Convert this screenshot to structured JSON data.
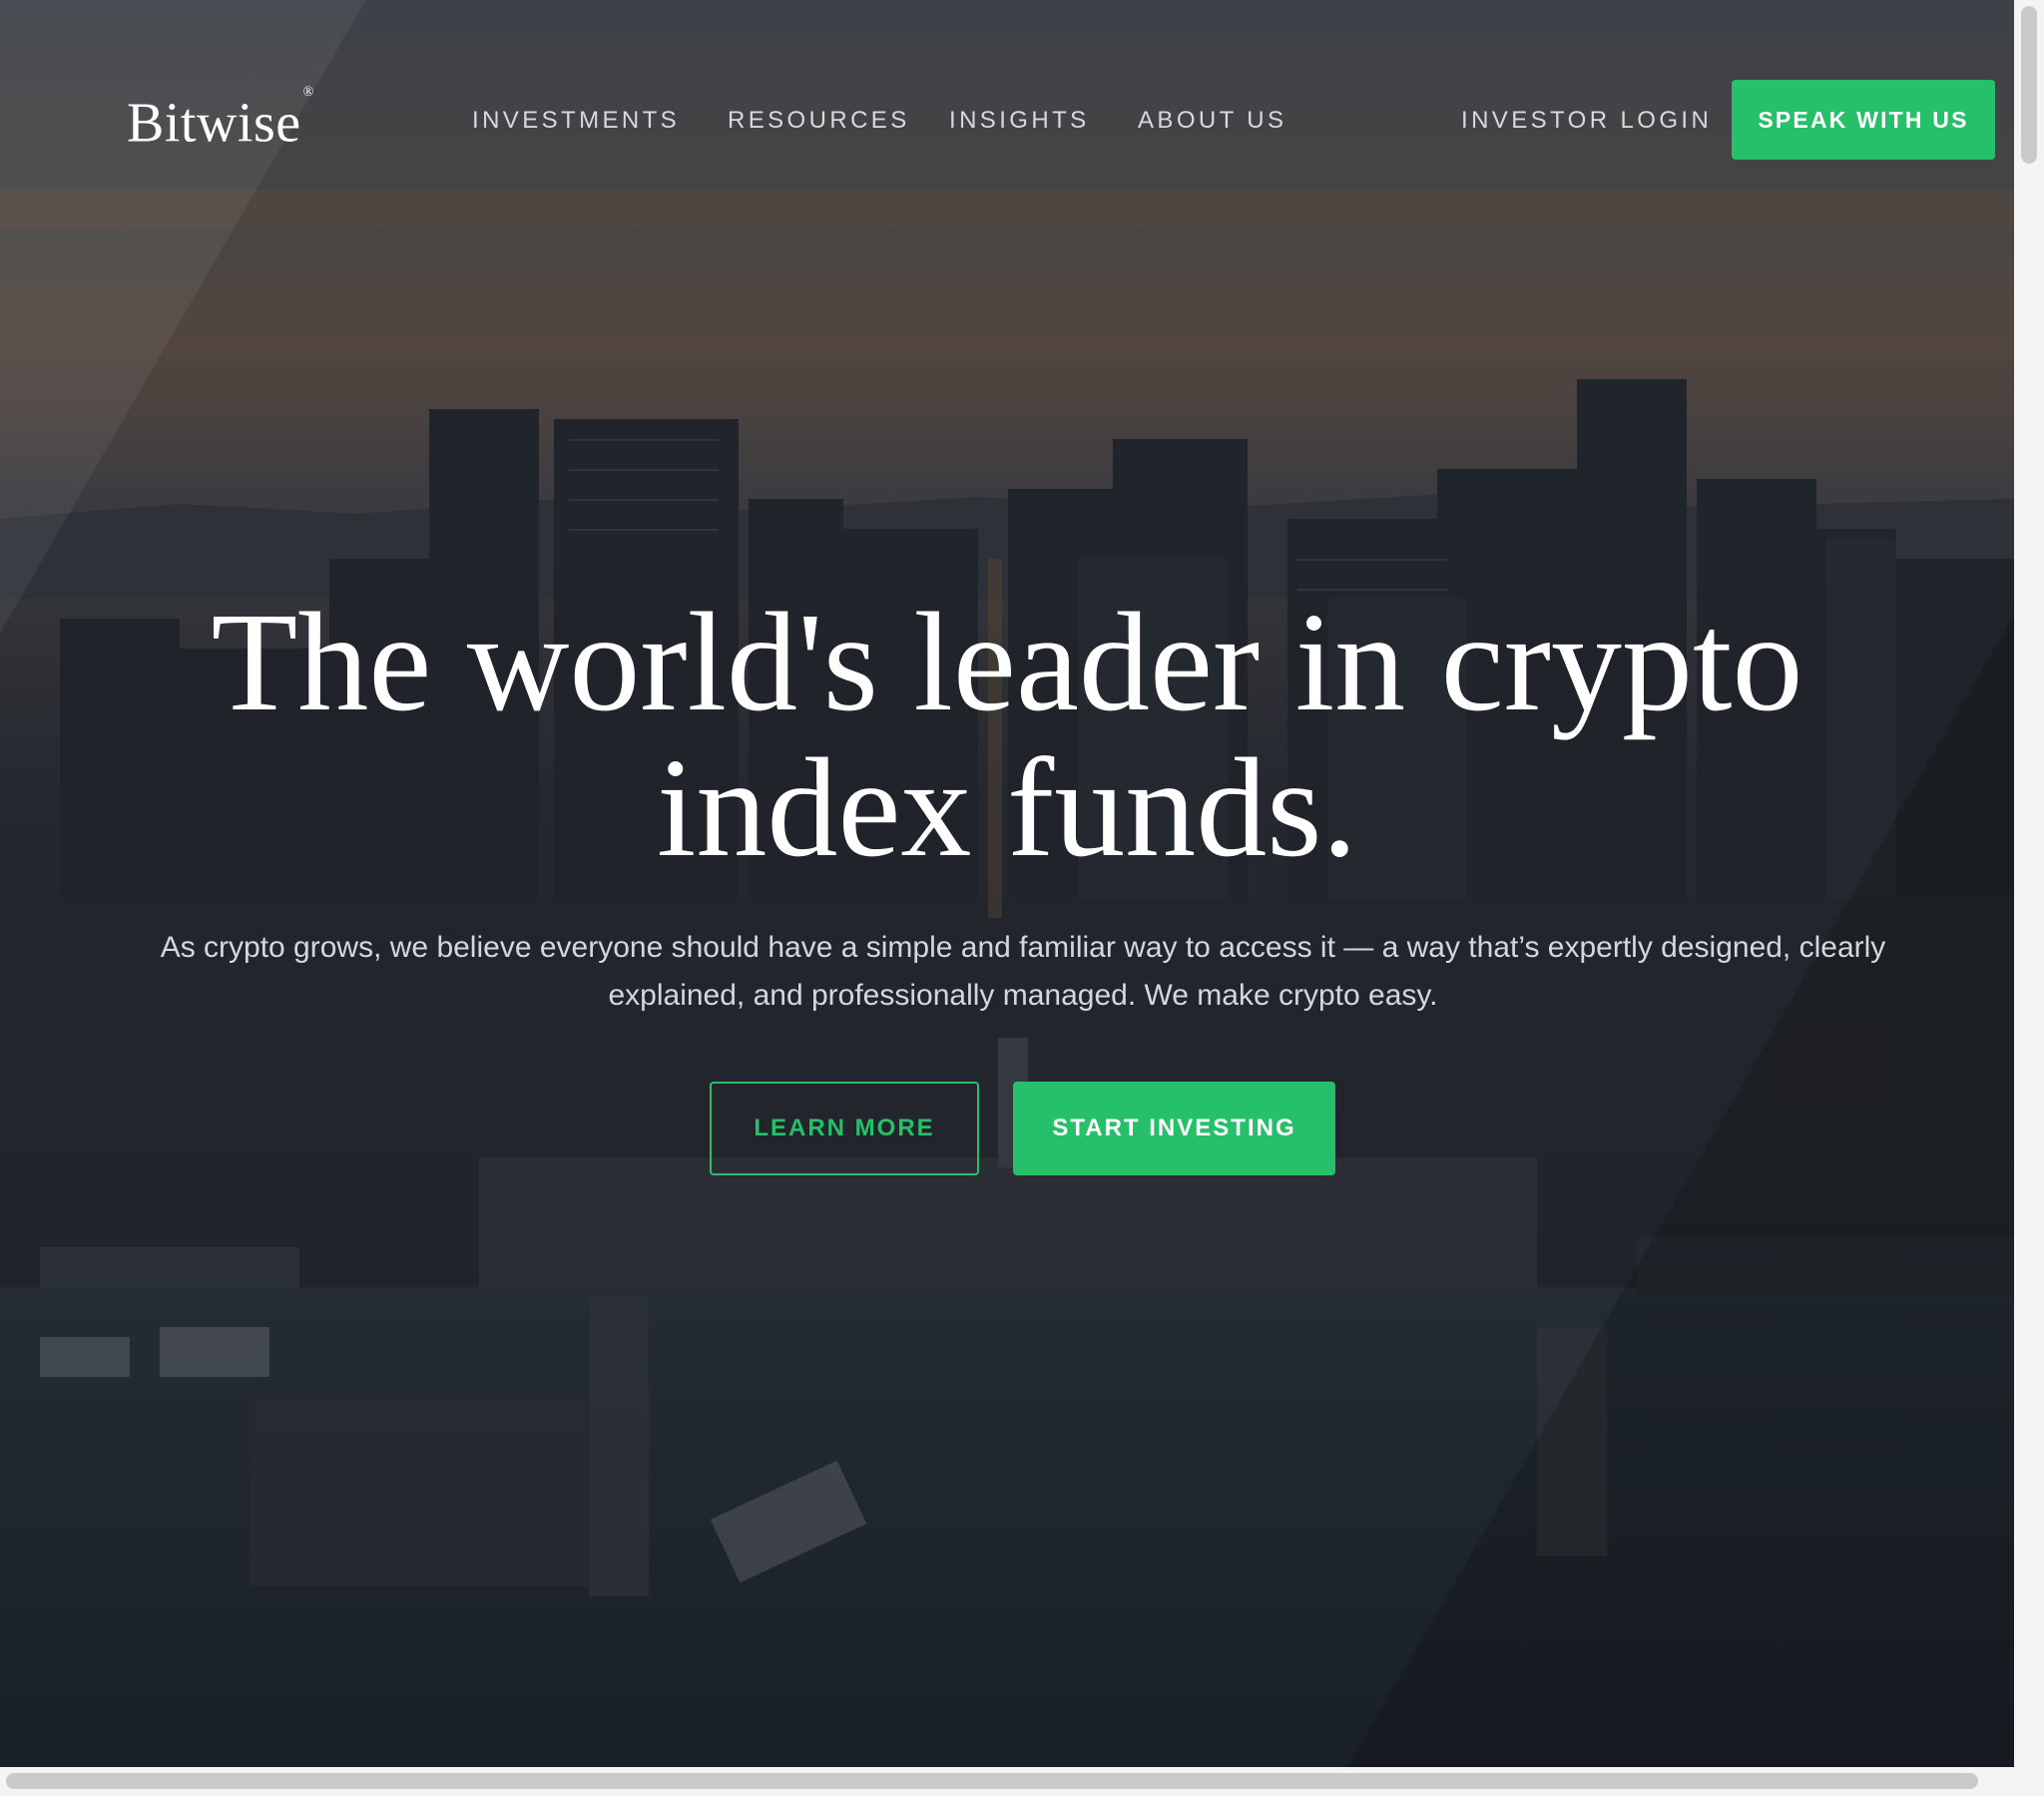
{
  "header": {
    "logo": "Bitwise",
    "logo_mark": "®",
    "nav": [
      {
        "label": "INVESTMENTS"
      },
      {
        "label": "RESOURCES"
      },
      {
        "label": "INSIGHTS"
      },
      {
        "label": "ABOUT US"
      }
    ],
    "login_label": "INVESTOR LOGIN",
    "cta_label": "SPEAK WITH US"
  },
  "hero": {
    "title": "The world's leader in crypto index funds.",
    "subtitle": "As crypto grows, we believe everyone should have a simple and familiar way to access it — a way that’s expertly designed, clearly explained, and professionally managed. We make crypto easy.",
    "learn_more_label": "LEARN MORE",
    "start_label": "START INVESTING",
    "background": "city-waterfront-dusk"
  },
  "colors": {
    "accent": "#27c06a",
    "nav_text": "#d6d9dd"
  }
}
